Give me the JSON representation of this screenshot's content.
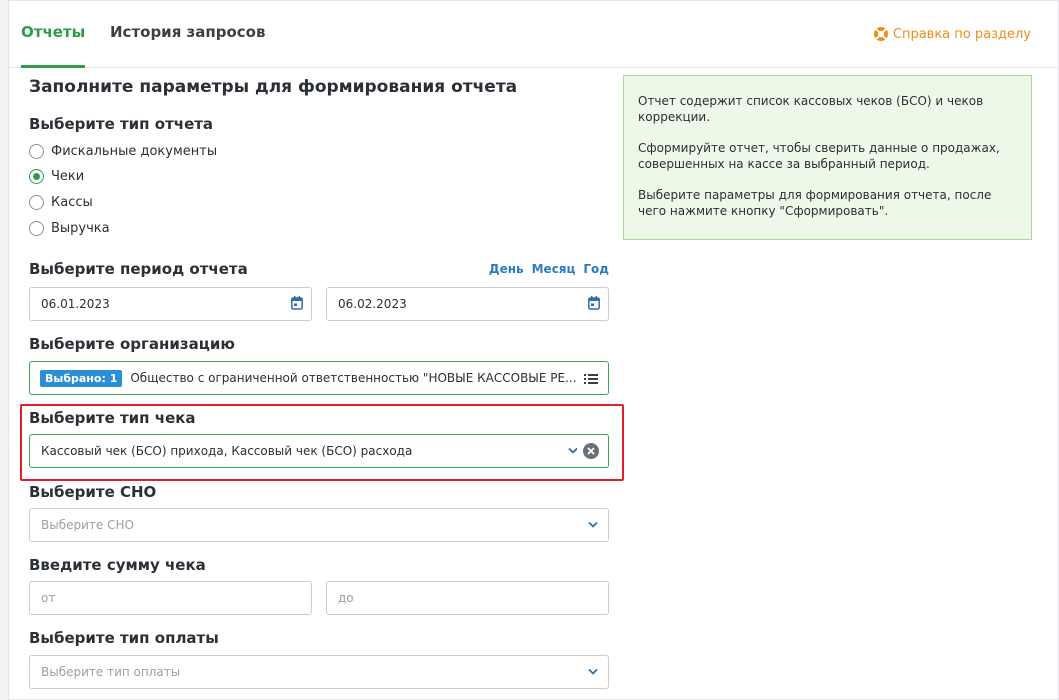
{
  "tabs": [
    {
      "label": "Отчеты",
      "active": true
    },
    {
      "label": "История запросов",
      "active": false
    }
  ],
  "help": {
    "label": "Справка по разделу",
    "icon": "lifebuoy-icon",
    "color": "#f08c1b"
  },
  "form": {
    "title": "Заполните параметры для формирования отчета",
    "report_type": {
      "label": "Выберите тип отчета",
      "options": [
        {
          "label": "Фискальные документы",
          "selected": false
        },
        {
          "label": "Чеки",
          "selected": true
        },
        {
          "label": "Кассы",
          "selected": false
        },
        {
          "label": "Выручка",
          "selected": false
        }
      ]
    },
    "period": {
      "label": "Выберите период отчета",
      "links": [
        "День",
        "Месяц",
        "Год"
      ],
      "from": "06.01.2023",
      "to": "06.02.2023"
    },
    "organization": {
      "label": "Выберите организацию",
      "badge": "Выбрано: 1",
      "value": "Общество с ограниченной ответственностью \"НОВЫЕ КАССОВЫЕ РЕ..."
    },
    "receipt_type": {
      "label": "Выберите тип чека",
      "value": "Кассовый чек (БСО) прихода, Кассовый чек (БСО) расхода"
    },
    "sno": {
      "label": "Выберите СНО",
      "placeholder": "Выберите СНО"
    },
    "amount": {
      "label": "Введите сумму чека",
      "from_placeholder": "от",
      "to_placeholder": "до"
    },
    "payment_type": {
      "label": "Выберите тип оплаты",
      "placeholder": "Выберите тип оплаты"
    }
  },
  "info": {
    "paragraphs": [
      "Отчет содержит список кассовых чеков (БСО) и чеков коррекции.",
      "Сформируйте отчет, чтобы сверить данные о продажах, совершенных на кассе за выбранный период.",
      "Выберите параметры для формирования отчета, после чего нажмите кнопку \"Сформировать\"."
    ]
  },
  "colors": {
    "accent": "#2e9a4a",
    "link": "#2b7bc2",
    "highlight": "#e0202a",
    "info_bg": "#eef8e9"
  }
}
